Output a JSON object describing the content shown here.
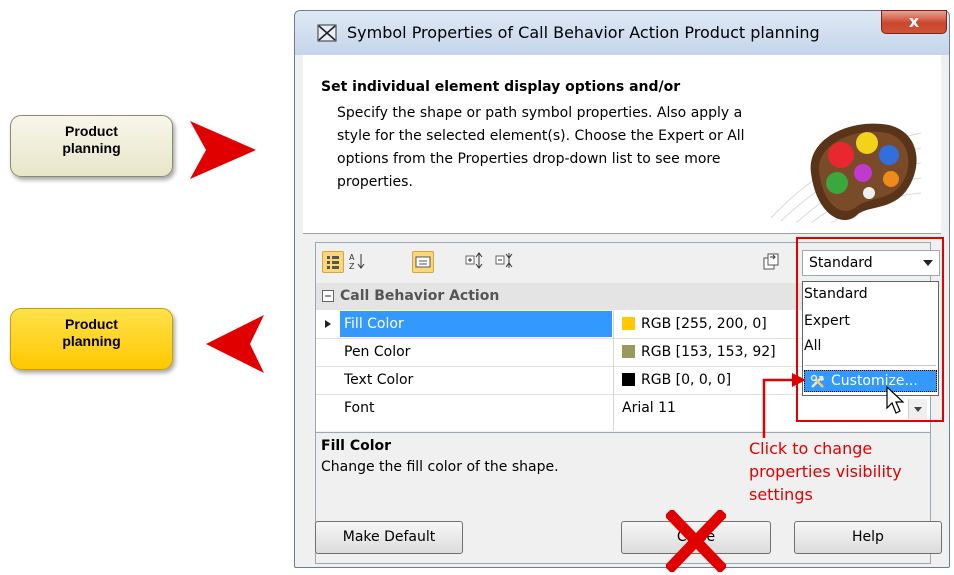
{
  "symbols": {
    "before_label_line1": "Product",
    "before_label_line2": "planning",
    "after_label_line1": "Product",
    "after_label_line2": "planning"
  },
  "dialog": {
    "title": "Symbol Properties of Call Behavior Action Product planning",
    "close_glyph": "x",
    "header_title": "Set individual element display options and/or",
    "header_desc": "Specify the shape or path symbol properties. Also apply a style for the selected element(s). Choose the Expert or All options from the Properties drop-down list to see more properties.",
    "filter_select": {
      "value": "Standard",
      "options": [
        "Standard",
        "Expert",
        "All"
      ],
      "customize_label": "Customize..."
    },
    "category": "Call Behavior Action",
    "properties": [
      {
        "name": "Fill Color",
        "value": "RGB [255, 200, 0]",
        "swatch": "#ffc800"
      },
      {
        "name": "Pen Color",
        "value": "RGB [153, 153, 92]",
        "swatch": "#99995c"
      },
      {
        "name": "Text Color",
        "value": "RGB [0, 0, 0]",
        "swatch": "#000000"
      },
      {
        "name": "Font",
        "value": "Arial 11",
        "swatch": ""
      }
    ],
    "description": {
      "title": "Fill Color",
      "text": "Change the fill color of the shape."
    },
    "buttons": {
      "make_default": "Make Default",
      "close": "Close",
      "help": "Help"
    }
  },
  "annotation": {
    "line1": "Click to change",
    "line2": "properties visibility",
    "line3": "settings"
  },
  "colors": {
    "accent_red": "#e80000",
    "selection_blue": "#3399ff"
  }
}
